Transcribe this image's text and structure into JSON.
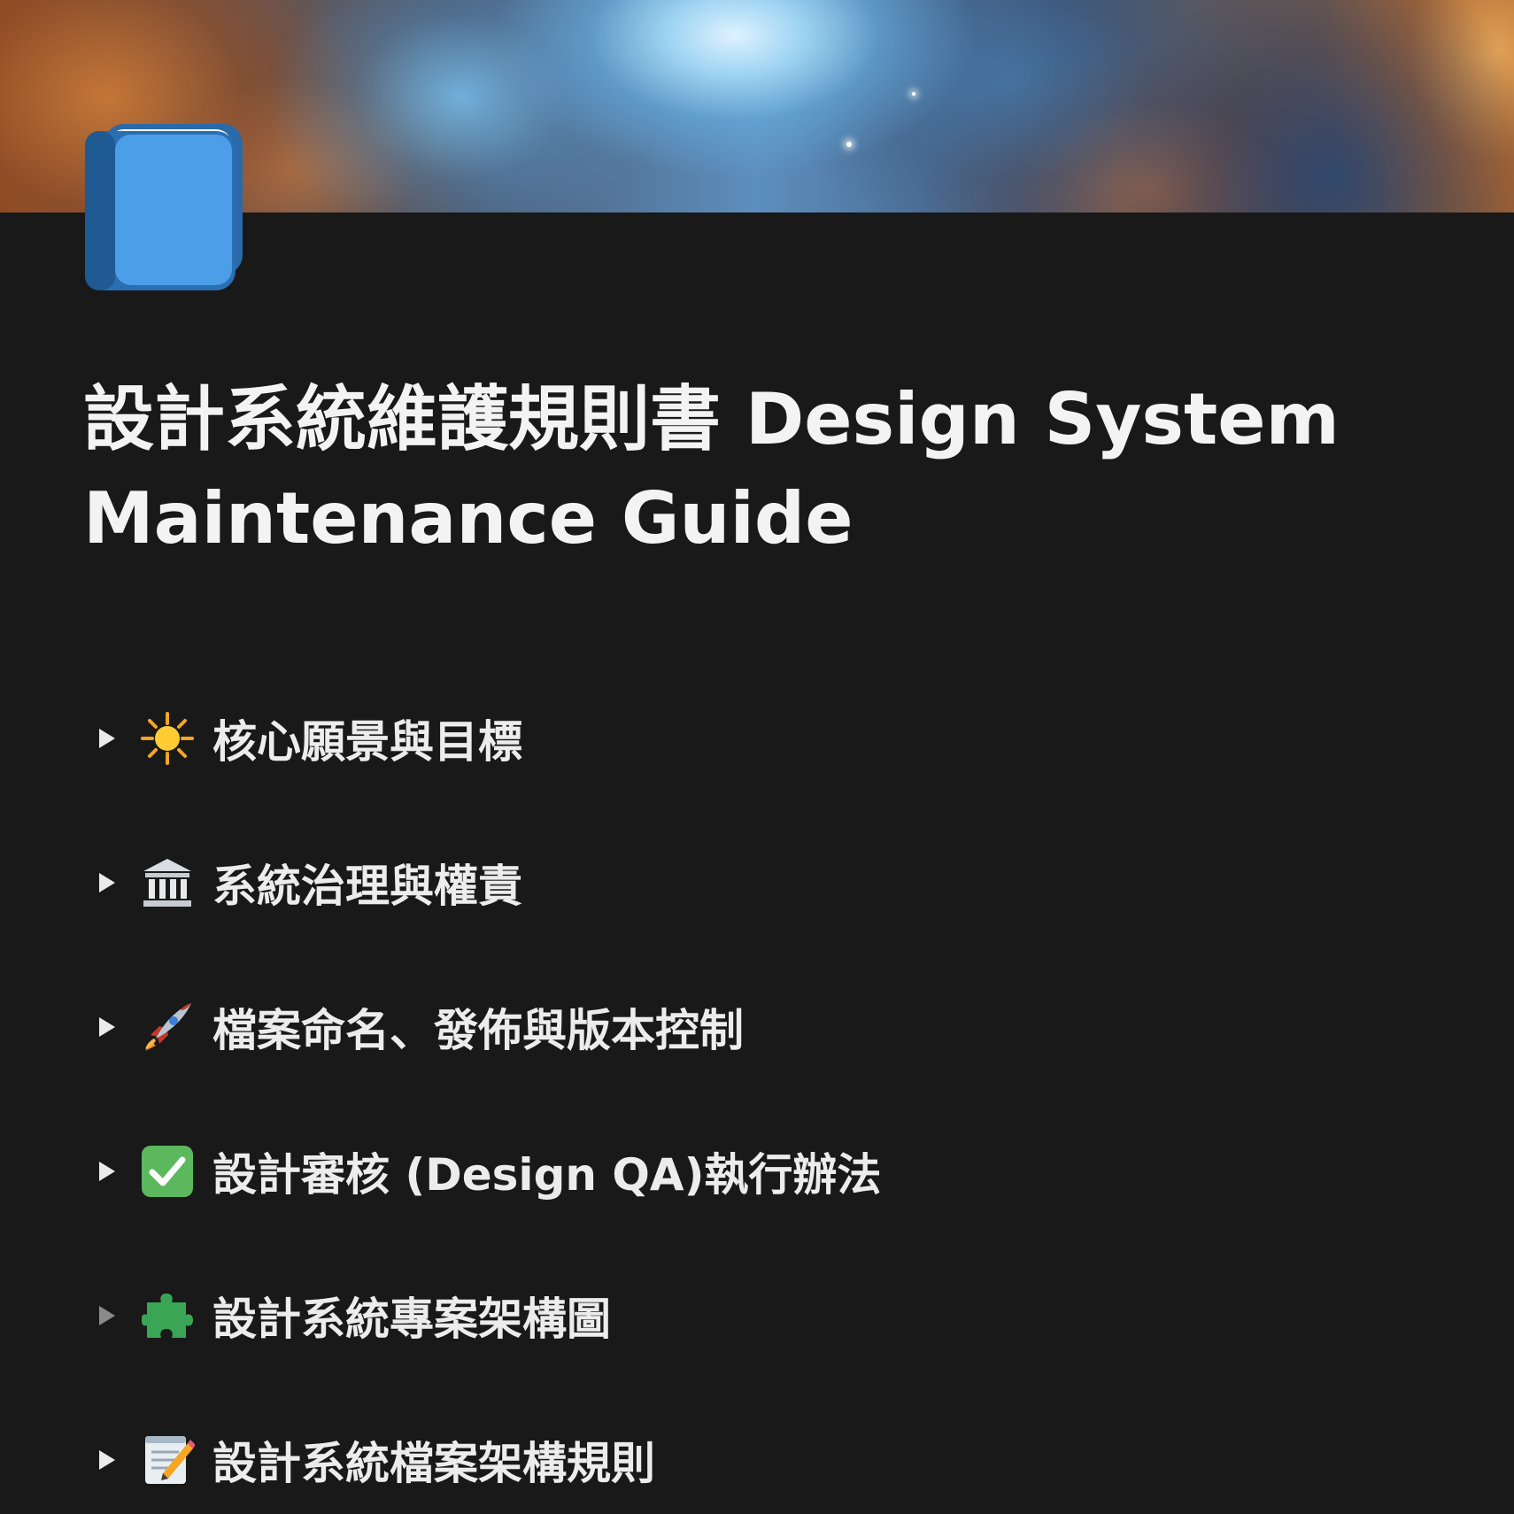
{
  "page": {
    "title": "設計系統維護規則書 Design System Maintenance Guide",
    "icon": "blue-book-icon",
    "cover": "nebula-cover-image"
  },
  "toggles": [
    {
      "label": "核心願景與目標",
      "icon": "sparkle-icon"
    },
    {
      "label": "系統治理與權責",
      "icon": "classical-building-icon"
    },
    {
      "label": "檔案命名、發佈與版本控制",
      "icon": "rocket-icon"
    },
    {
      "label": "設計審核 (Design QA)執行辦法",
      "icon": "check-mark-button-icon"
    },
    {
      "label": "設計系統專案架構圖",
      "icon": "puzzle-piece-icon"
    },
    {
      "label": "設計系統檔案架構規則",
      "icon": "memo-icon"
    }
  ],
  "colors": {
    "background": "#191919",
    "text": "#ececec",
    "toggle_arrow": "#ebebeb",
    "toggle_arrow_dim": "#8a8a8a",
    "check_green": "#5cb85c"
  }
}
